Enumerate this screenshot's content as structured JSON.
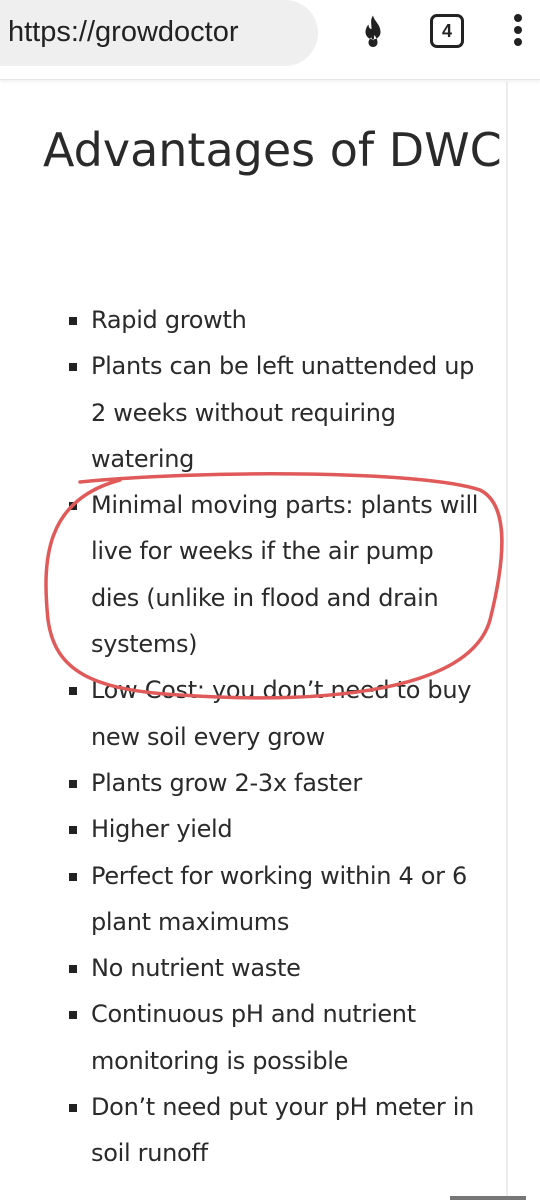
{
  "browser": {
    "url": "https://growdoctor",
    "tab_count": "4",
    "icons": [
      "fire-icon",
      "tabs-icon",
      "menu-icon"
    ]
  },
  "article": {
    "heading": "Advantages of DWC",
    "items": [
      "Rapid growth",
      "Plants can be left unattended up 2 weeks without requiring watering",
      "Minimal moving parts: plants will live for weeks if the air pump dies (unlike in flood and drain systems)",
      "Low Cost: you don’t need to buy new soil every grow",
      "Plants grow 2-3x faster",
      "Higher yield",
      "Perfect for working within 4 or 6 plant maximums",
      "No nutrient waste",
      "Continuous pH and nutrient monitoring is possible",
      "Don’t need put your pH meter in soil runoff"
    ]
  },
  "annotation": {
    "color": "#e05a5a",
    "circled_item": "Minimal moving parts: plants will live for weeks if the air pump dies (unlike in flood and drain systems)"
  }
}
